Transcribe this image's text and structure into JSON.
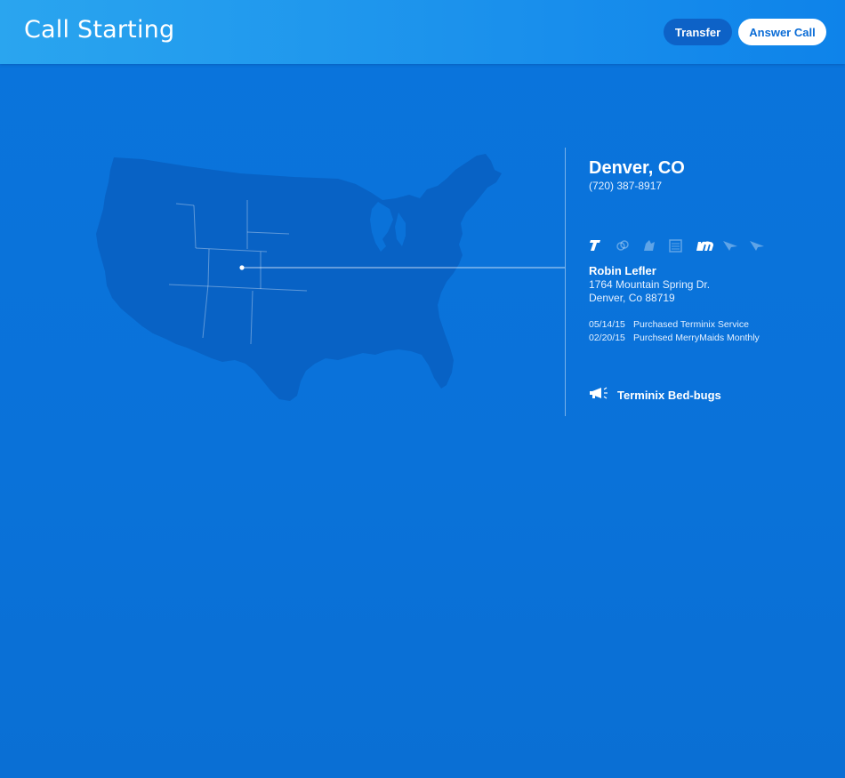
{
  "header": {
    "title": "Call Starting",
    "transfer_label": "Transfer",
    "answer_label": "Answer Call"
  },
  "caller": {
    "location": "Denver, CO",
    "phone": "(720) 387-8917"
  },
  "brands": [
    {
      "name": "terminix-logo-icon",
      "active": true
    },
    {
      "name": "servicemaster-logo-icon",
      "active": false
    },
    {
      "name": "trugreen-logo-icon",
      "active": false
    },
    {
      "name": "amerispec-logo-icon",
      "active": false
    },
    {
      "name": "merrymaids-logo-icon",
      "active": true
    },
    {
      "name": "furniture-medic-logo-icon",
      "active": false
    },
    {
      "name": "american-home-shield-logo-icon",
      "active": false
    }
  ],
  "customer": {
    "name": "Robin Lefler",
    "address_line1": "1764 Mountain Spring Dr.",
    "address_line2": "Denver, Co  88719"
  },
  "history": [
    {
      "date": "05/14/15",
      "description": "Purchased Terminix Service"
    },
    {
      "date": "02/20/15",
      "description": "Purchsed MerryMaids Monthly"
    }
  ],
  "campaign": {
    "icon": "megaphone-icon",
    "label": "Terminix Bed-bugs"
  },
  "colors": {
    "background": "#0a72d9",
    "header": "#1a90ec",
    "accent": "#ffffff"
  }
}
